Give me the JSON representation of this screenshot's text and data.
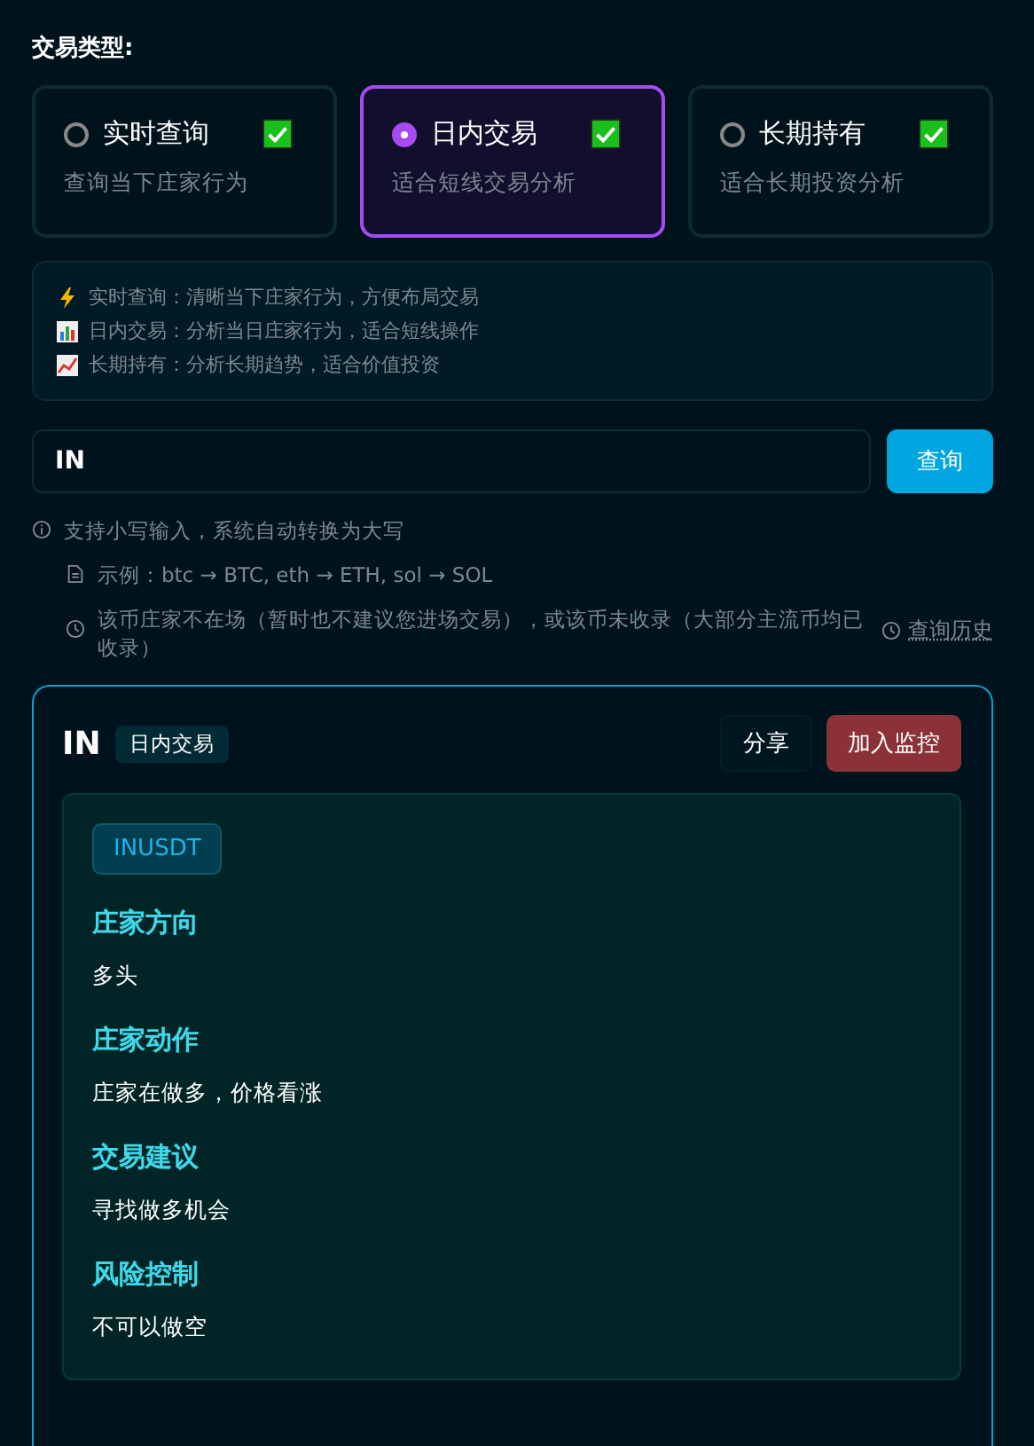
{
  "section_label": "交易类型:",
  "trade_types": [
    {
      "title": "实时查询",
      "description": "查询当下庄家行为",
      "selected": false,
      "checked": true
    },
    {
      "title": "日内交易",
      "description": "适合短线交易分析",
      "selected": true,
      "checked": true
    },
    {
      "title": "长期持有",
      "description": "适合长期投资分析",
      "selected": false,
      "checked": true
    }
  ],
  "tips": [
    {
      "kind": "lightning",
      "text": "实时查询：清晰当下庄家行为，方便布局交易"
    },
    {
      "kind": "bar",
      "text": "日内交易：分析当日庄家行为，适合短线操作"
    },
    {
      "kind": "trend",
      "text": "长期持有：分析长期趋势，适合价值投资"
    }
  ],
  "search": {
    "value": "IN",
    "button": "查询"
  },
  "hints": [
    {
      "kind": "info",
      "text": "支持小写输入，系统自动转换为大写"
    },
    {
      "kind": "doc",
      "text": "示例：btc → BTC, eth → ETH, sol → SOL"
    },
    {
      "kind": "clock",
      "text": "该币庄家不在场（暂时也不建议您进场交易），或该币未收录（大部分主流币均已收录）"
    }
  ],
  "history_link": "查询历史",
  "result": {
    "symbol": "IN",
    "type_tag": "日内交易",
    "share_button": "分享",
    "monitor_button": "加入监控",
    "pair": "INUSDT",
    "sections": [
      {
        "heading": "庄家方向",
        "body": "多头"
      },
      {
        "heading": "庄家动作",
        "body": "庄家在做多，价格看涨"
      },
      {
        "heading": "交易建议",
        "body": "寻找做多机会"
      },
      {
        "heading": "风险控制",
        "body": "不可以做空"
      }
    ]
  }
}
